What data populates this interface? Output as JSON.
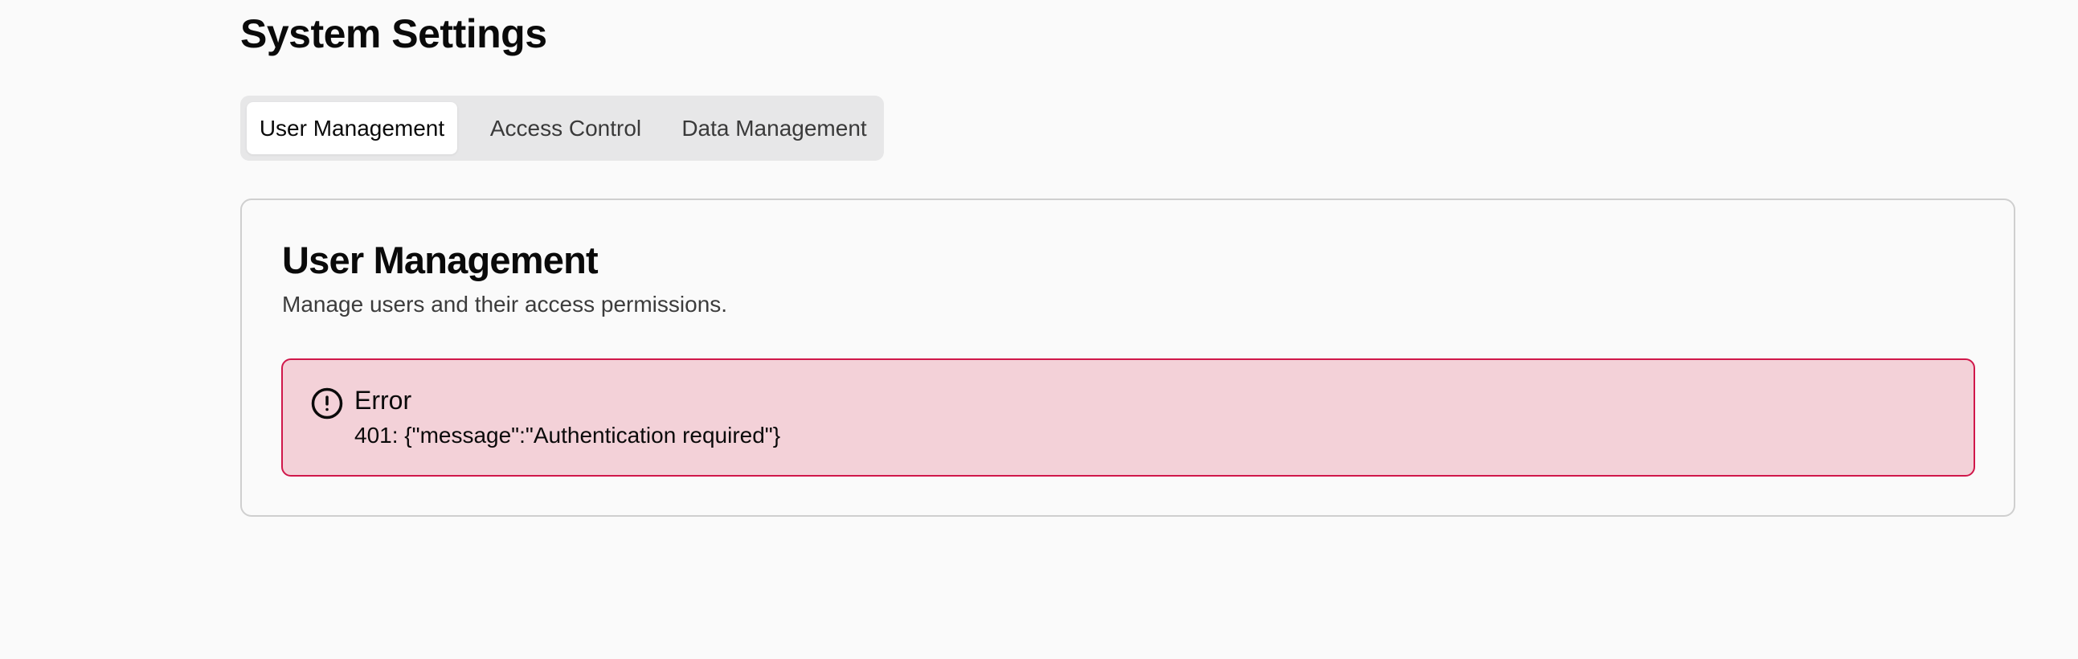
{
  "page": {
    "title": "System Settings"
  },
  "tabs": [
    {
      "label": "User Management",
      "active": true
    },
    {
      "label": "Access Control",
      "active": false
    },
    {
      "label": "Data Management",
      "active": false
    }
  ],
  "card": {
    "title": "User Management",
    "description": "Manage users and their access permissions."
  },
  "alert": {
    "icon": "alert-circle-icon",
    "title": "Error",
    "message": "401: {\"message\":\"Authentication required\"}"
  },
  "colors": {
    "background": "#fafafa",
    "tab_list_bg": "#e7e7e8",
    "alert_bg": "#f3d1d8",
    "alert_border": "#d0174a"
  }
}
